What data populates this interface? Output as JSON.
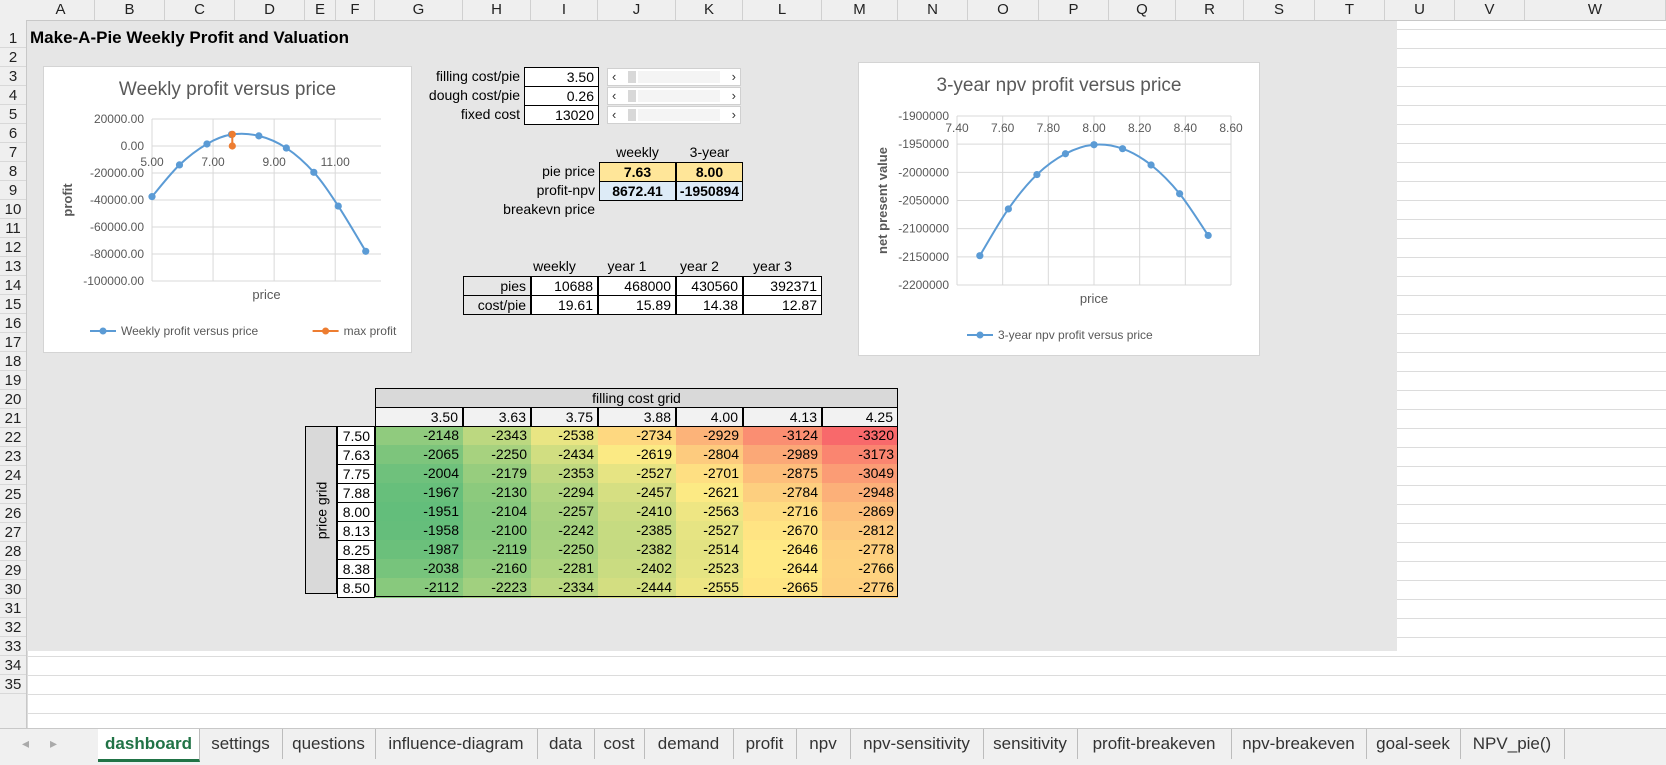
{
  "columns": [
    "A",
    "B",
    "C",
    "D",
    "E",
    "F",
    "G",
    "H",
    "I",
    "J",
    "K",
    "L",
    "M",
    "N",
    "O",
    "P",
    "Q",
    "R",
    "S",
    "T",
    "U",
    "V",
    "W"
  ],
  "rows": [
    "1",
    "2",
    "3",
    "4",
    "5",
    "6",
    "7",
    "8",
    "9",
    "10",
    "11",
    "12",
    "13",
    "14",
    "15",
    "16",
    "17",
    "18",
    "19",
    "20",
    "21",
    "22",
    "23",
    "24",
    "25",
    "26",
    "27",
    "28",
    "29",
    "30",
    "31",
    "32",
    "33",
    "34",
    "35"
  ],
  "title": "Make-A-Pie Weekly Profit and Valuation",
  "inputs": [
    {
      "label": "filling cost/pie",
      "value": "3.50"
    },
    {
      "label": "dough cost/pie",
      "value": "0.26"
    },
    {
      "label": "fixed cost",
      "value": "13020"
    }
  ],
  "slider_arrows": {
    "left": "‹",
    "right": "›"
  },
  "summary": {
    "col_weekly": "weekly",
    "col_3year": "3-year",
    "pie_price_label": "pie price",
    "pie_price_weekly": "7.63",
    "pie_price_3year": "8.00",
    "profit_label": "profit-npv",
    "profit_weekly": "8672.41",
    "profit_3year": "-1950894",
    "breakeven_label": "breakevn price"
  },
  "volume": {
    "headers": [
      "weekly",
      "year 1",
      "year 2",
      "year 3"
    ],
    "rows": [
      {
        "label": "pies",
        "values": [
          "10688",
          "468000",
          "430560",
          "392371"
        ]
      },
      {
        "label": "cost/pie",
        "values": [
          "19.61",
          "15.89",
          "14.38",
          "12.87"
        ]
      }
    ]
  },
  "grid": {
    "title": "filling cost grid",
    "row_axis_label": "price grid",
    "filling_costs": [
      "3.50",
      "3.63",
      "3.75",
      "3.88",
      "4.00",
      "4.13",
      "4.25"
    ],
    "prices": [
      "7.50",
      "7.63",
      "7.75",
      "7.88",
      "8.00",
      "8.13",
      "8.25",
      "8.38",
      "8.50"
    ],
    "values": [
      [
        "-2148",
        "-2343",
        "-2538",
        "-2734",
        "-2929",
        "-3124",
        "-3320"
      ],
      [
        "-2065",
        "-2250",
        "-2434",
        "-2619",
        "-2804",
        "-2989",
        "-3173"
      ],
      [
        "-2004",
        "-2179",
        "-2353",
        "-2527",
        "-2701",
        "-2875",
        "-3049"
      ],
      [
        "-1967",
        "-2130",
        "-2294",
        "-2457",
        "-2621",
        "-2784",
        "-2948"
      ],
      [
        "-1951",
        "-2104",
        "-2257",
        "-2410",
        "-2563",
        "-2716",
        "-2869"
      ],
      [
        "-1958",
        "-2100",
        "-2242",
        "-2385",
        "-2527",
        "-2670",
        "-2812"
      ],
      [
        "-1987",
        "-2119",
        "-2250",
        "-2382",
        "-2514",
        "-2646",
        "-2778"
      ],
      [
        "-2038",
        "-2160",
        "-2281",
        "-2402",
        "-2523",
        "-2644",
        "-2766"
      ],
      [
        "-2112",
        "-2223",
        "-2334",
        "-2444",
        "-2555",
        "-2665",
        "-2776"
      ]
    ]
  },
  "chart_data": [
    {
      "type": "line",
      "title": "Weekly profit versus price",
      "xlabel": "price",
      "ylabel": "profit",
      "x_ticks": [
        "5.00",
        "7.00",
        "9.00",
        "11.00"
      ],
      "y_ticks": [
        "20000.00",
        "0.00",
        "-20000.00",
        "-40000.00",
        "-60000.00",
        "-80000.00",
        "-100000.00"
      ],
      "xlim": [
        5,
        12.5
      ],
      "ylim": [
        -100000,
        20000
      ],
      "series": [
        {
          "name": "Weekly profit versus price",
          "color": "#5b9bd5",
          "x": [
            5.0,
            5.9,
            6.8,
            7.6,
            8.5,
            9.4,
            10.3,
            11.1,
            12.0
          ],
          "y": [
            -37500,
            -14000,
            1500,
            8500,
            7500,
            -1500,
            -19500,
            -44500,
            -78000
          ]
        },
        {
          "name": "max profit",
          "color": "#ed7d31",
          "x": [
            7.63,
            7.63
          ],
          "y": [
            8672,
            0
          ]
        }
      ],
      "legend": "bottom",
      "grid": true
    },
    {
      "type": "line",
      "title": "3-year npv profit versus price",
      "xlabel": "price",
      "ylabel": "net present value",
      "x_ticks": [
        "7.40",
        "7.60",
        "7.80",
        "8.00",
        "8.20",
        "8.40",
        "8.60"
      ],
      "y_ticks": [
        "-1900000",
        "-1950000",
        "-2000000",
        "-2050000",
        "-2100000",
        "-2150000",
        "-2200000"
      ],
      "xlim": [
        7.4,
        8.6
      ],
      "ylim": [
        -2200000,
        -1900000
      ],
      "series": [
        {
          "name": "3-year npv profit versus price",
          "color": "#5b9bd5",
          "x": [
            7.5,
            7.625,
            7.75,
            7.875,
            8.0,
            8.125,
            8.25,
            8.375,
            8.5
          ],
          "y": [
            -2148000,
            -2065000,
            -2004000,
            -1967000,
            -1951000,
            -1958000,
            -1987000,
            -2038000,
            -2112000
          ]
        }
      ],
      "legend": "bottom",
      "grid": true
    }
  ],
  "tabs": [
    "dashboard",
    "settings",
    "questions",
    "influence-diagram",
    "data",
    "cost",
    "demand",
    "profit",
    "npv",
    "npv-sensitivity",
    "sensitivity",
    "profit-breakeven",
    "npv-breakeven",
    "goal-seek",
    "NPV_pie()"
  ],
  "active_tab": "dashboard",
  "colors": {
    "grid_green": "#63be7b",
    "grid_yellow": "#ffeb84",
    "grid_red": "#f8696b",
    "highlight": "#ffe699",
    "selected_blue": "#ddebf7"
  }
}
